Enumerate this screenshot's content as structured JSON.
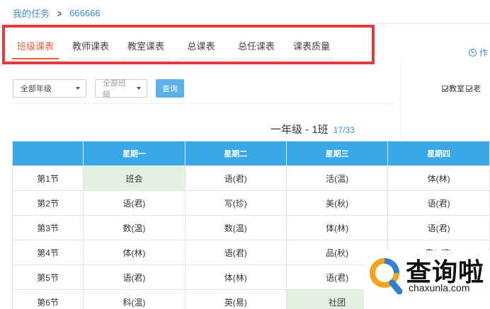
{
  "breadcrumb": {
    "parent": "我的任务",
    "current": "666666"
  },
  "tabs": [
    {
      "label": "班级课表",
      "active": true
    },
    {
      "label": "教师课表",
      "active": false
    },
    {
      "label": "教室课表",
      "active": false
    },
    {
      "label": "总课表",
      "active": false
    },
    {
      "label": "总任课表",
      "active": false
    },
    {
      "label": "课表质量",
      "active": false
    }
  ],
  "right_hint": {
    "icon": "clock-icon",
    "label": "作"
  },
  "filters": {
    "grade_select": "全部年级",
    "class_select": "全部班级",
    "query_button": "查询"
  },
  "checkboxes": [
    {
      "label": "教室",
      "checked": true
    },
    {
      "label": "老",
      "checked": true
    }
  ],
  "table_title": {
    "name": "一年级 - 1班",
    "count": "17/33"
  },
  "schedule": {
    "headers": [
      "",
      "星期一",
      "星期二",
      "星期三",
      "星期四"
    ],
    "rows": [
      {
        "period": "第1节",
        "cells": [
          "班会",
          "语(君)",
          "活(温)",
          "体(林)"
        ]
      },
      {
        "period": "第2节",
        "cells": [
          "语(君)",
          "写(珍)",
          "美(秋)",
          "语(君)"
        ]
      },
      {
        "period": "第3节",
        "cells": [
          "数(温)",
          "数(温)",
          "体(林)",
          "语(君)"
        ]
      },
      {
        "period": "第4节",
        "cells": [
          "体(林)",
          "语(君)",
          "品(秋)",
          "音1(魂)"
        ]
      },
      {
        "period": "第5节",
        "cells": [
          "语(君)",
          "体(林)",
          "语(君)",
          ""
        ]
      },
      {
        "period": "第6节",
        "cells": [
          "科(温)",
          "英(易)",
          "社团",
          ""
        ]
      }
    ],
    "highlight_color": "#e3f2e0",
    "header_color": "#3aa8e8"
  },
  "watermark": {
    "brand": "查询啦",
    "url": "chaxunla.com"
  },
  "colors": {
    "accent": "#e4623a",
    "link": "#3a8fd6",
    "frame": "#e33b3b",
    "button": "#5db1e8"
  }
}
